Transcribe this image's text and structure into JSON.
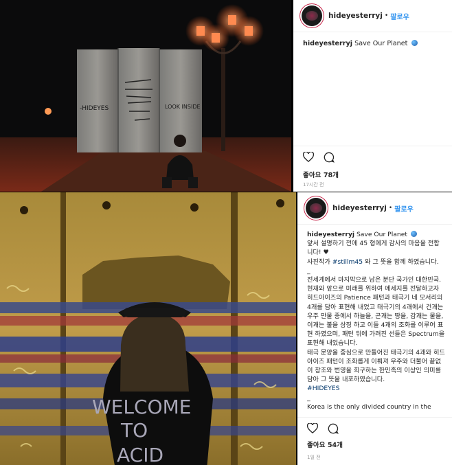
{
  "post1": {
    "username": "hideyesterryj",
    "separator": "•",
    "follow_label": "팔로우",
    "caption_user": "hideyesterryj",
    "caption_text": "Save Our Planet",
    "likes": "좋아요 78개",
    "time": "17시간 전",
    "photo_texts": [
      "-HIDEYES",
      "LOOK INSIDE"
    ]
  },
  "post2": {
    "username": "hideyesterryj",
    "separator": "•",
    "follow_label": "팔로우",
    "caption_user": "hideyesterryj",
    "caption_line1": "Save Our Planet",
    "caption_line2": "앞서 설명하기 전에 45 형에게 감사의 마음을 전합니다!",
    "caption_photographer_pre": "사진작가",
    "caption_photographer_tag": "#stillm45",
    "caption_photographer_post": "와 그 뜻을 함께 하였습니다.",
    "dash1": "_",
    "caption_body": "전세계에서 마지막으로 남은 분단 국가인 대한민국. 현재와 앞으로 미래를 위하여 메세지를 전달하고자 히드아이즈의 Patience 패턴과 태극기 네 모서리의 4괘를 담아 표현해 내었고 태극기의 4괘에서 건괘는 우주 만물 중에서 하늘을, 곤괘는 땅을, 감괘는 물을, 이괘는 불을 상징 하고 이들 4괘의 조화를 이루어 표현 하였으며, 패턴 뒤에 가려진 선들은 Spectrum을 표현해 내었습니다.",
    "caption_body2": "태극 문양을 중심으로 만들어진 태극기의 4괘와 히드아이즈 패턴이 조화롭게 이뤄져 우주와 더불어 끝없이 창조와 번영을 희구하는 한민족의 이상인 의미를 담아 그 뜻을 내포하였습니다.",
    "caption_hashtag": "#HIDEYES",
    "dash2": "_",
    "caption_english": "Korea is the only divided country in the",
    "likes": "좋아요 54개",
    "time": "1일 전",
    "shirt_text": [
      "WELCOME",
      "TO",
      "ACID"
    ]
  },
  "icons": [
    "heart-icon",
    "comment-icon",
    "globe-icon",
    "black-heart-icon"
  ],
  "colors": {
    "follow": "#3897f0",
    "hashtag": "#003569",
    "street_light": "#ff6a3a"
  }
}
